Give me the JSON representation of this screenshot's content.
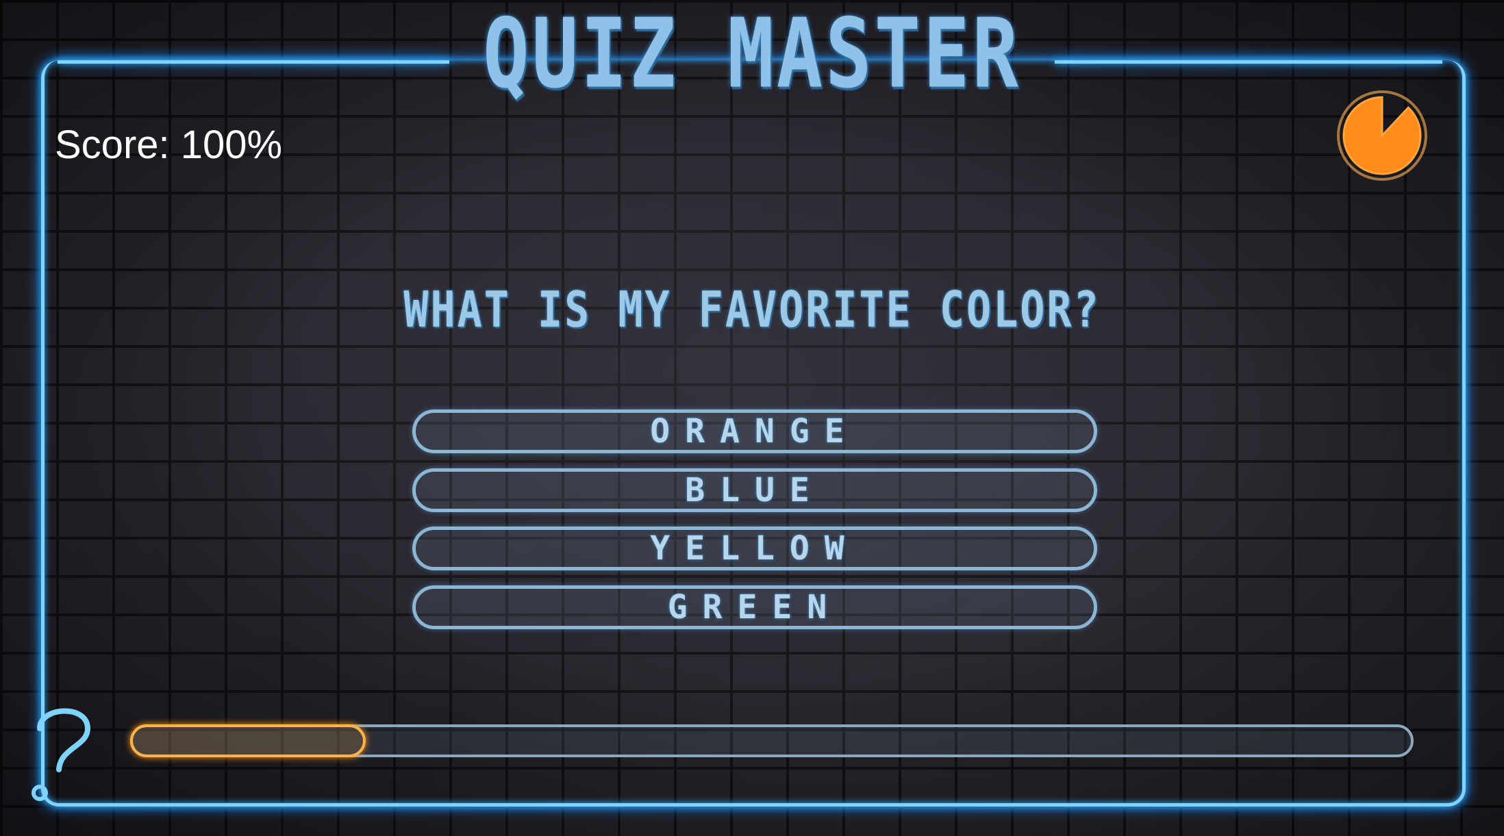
{
  "game": {
    "title": "QUIZ MASTER",
    "score_text": "Score: 100%",
    "question": "WHAT IS MY FAVORITE COLOR?",
    "answers": [
      "ORANGE",
      "BLUE",
      "YELLOW",
      "GREEN"
    ],
    "progress_fraction": 0.18,
    "timer_remaining_fraction": 0.88
  },
  "colors": {
    "neon_blue": "#7fd3ff",
    "timer_orange": "#ff8c1a",
    "progress_orange": "#ffb14a"
  },
  "icons": {
    "timer": "pie-timer-icon",
    "help": "question-mark-icon"
  }
}
